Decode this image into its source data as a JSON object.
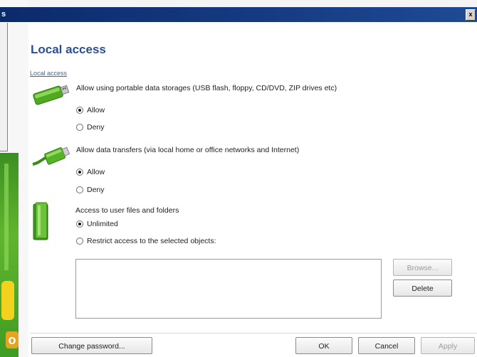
{
  "window": {
    "title": "s",
    "close_glyph": "x"
  },
  "page": {
    "title": "Local access",
    "section_link": "Local access"
  },
  "portable": {
    "description": "Allow using portable data storages (USB flash, floppy, CD/DVD, ZIP drives etc)",
    "icon": "usb-drive-icon",
    "options": [
      {
        "label": "Allow",
        "checked": true
      },
      {
        "label": "Deny",
        "checked": false
      }
    ]
  },
  "transfers": {
    "description": "Allow data transfers (via local home or office networks and Internet)",
    "icon": "network-cable-icon",
    "options": [
      {
        "label": "Allow",
        "checked": true
      },
      {
        "label": "Deny",
        "checked": false
      }
    ]
  },
  "files": {
    "description": "Access to user files and folders",
    "icon": "folder-icon",
    "options": [
      {
        "label": "Unlimited",
        "checked": true
      },
      {
        "label": "Restrict access to the selected objects:",
        "checked": false
      }
    ],
    "browse_label": "Browse...",
    "delete_label": "Delete"
  },
  "footer": {
    "change_password_label": "Change password...",
    "ok_label": "OK",
    "cancel_label": "Cancel",
    "apply_label": "Apply"
  },
  "colors": {
    "titlebar": "#0b2a6b",
    "heading": "#2b4f8f",
    "accent_green": "#5fb52d"
  }
}
